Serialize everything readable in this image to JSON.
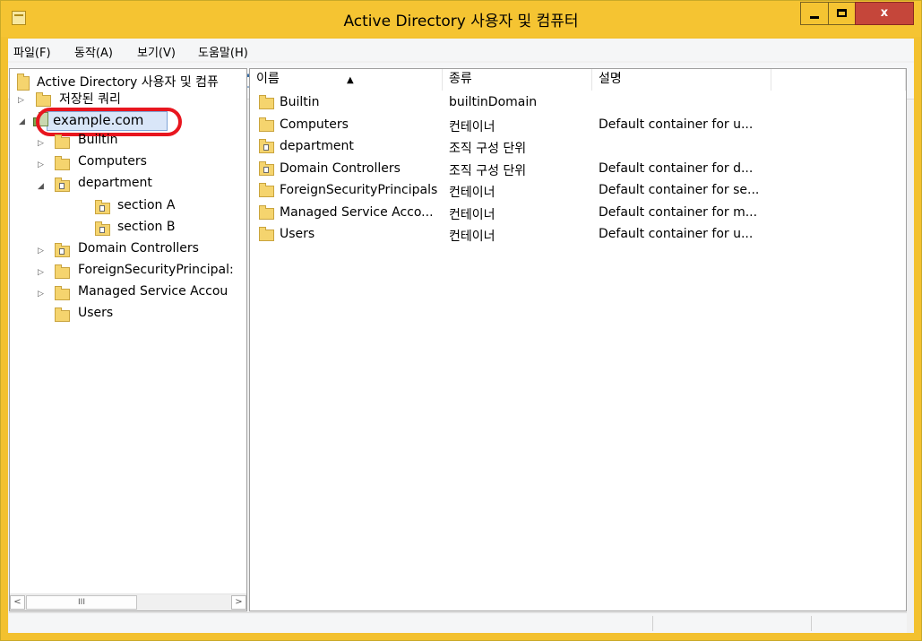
{
  "window": {
    "title": "Active Directory 사용자 및 컴퓨터",
    "close_label": "x"
  },
  "menu": [
    "파일(F)",
    "동작(A)",
    "보기(V)",
    "도움말(H)"
  ],
  "toolbar_icons": [
    "back-arrow-icon",
    "forward-arrow-icon",
    "up-folder-icon",
    "show-console-tree-icon",
    "properties-icon",
    "export-icon",
    "refresh-icon",
    "export-list-icon",
    "help-icon",
    "show-action-pane-icon",
    "new-user-icon",
    "new-group-icon",
    "new-ou-icon",
    "filter-icon",
    "find-icon",
    "delegate-icon"
  ],
  "tree": {
    "root": "Active Directory 사용자 및 컴퓨",
    "saved_queries": "저장된 쿼리",
    "domain": "example.com",
    "builtin": "Builtin",
    "computers": "Computers",
    "department": "department",
    "section_a": "section A",
    "section_b": "section B",
    "domain_controllers": "Domain Controllers",
    "fsp": "ForeignSecurityPrincipal:",
    "msa": "Managed Service Accou",
    "users": "Users",
    "scroll_thumb": "III"
  },
  "list": {
    "columns": [
      "이름",
      "종류",
      "설명"
    ],
    "rows": [
      {
        "name": "Builtin",
        "type": "builtinDomain",
        "desc": "",
        "ou": false
      },
      {
        "name": "Computers",
        "type": "컨테이너",
        "desc": "Default container for u...",
        "ou": false
      },
      {
        "name": "department",
        "type": "조직 구성 단위",
        "desc": "",
        "ou": true
      },
      {
        "name": "Domain Controllers",
        "type": "조직 구성 단위",
        "desc": "Default container for d...",
        "ou": true
      },
      {
        "name": "ForeignSecurityPrincipals",
        "type": "컨테이너",
        "desc": "Default container for se...",
        "ou": false
      },
      {
        "name": "Managed Service Acco...",
        "type": "컨테이너",
        "desc": "Default container for m...",
        "ou": false
      },
      {
        "name": "Users",
        "type": "컨테이너",
        "desc": "Default container for u...",
        "ou": false
      }
    ]
  },
  "colors": {
    "frame": "#f5c432",
    "selection": "#d9e6f8",
    "highlight_ring": "#e8161f"
  }
}
